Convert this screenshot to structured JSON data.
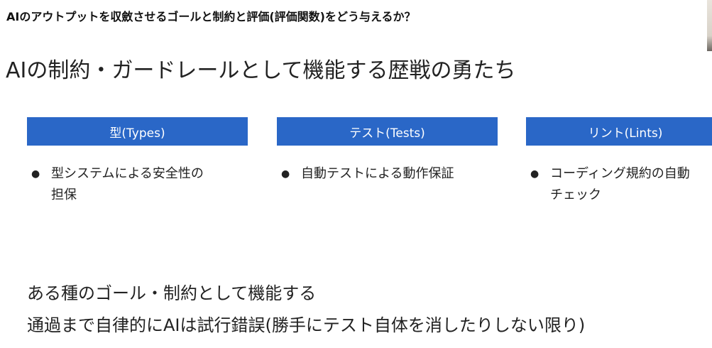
{
  "header": {
    "question": "AIのアウトプットを収斂させるゴールと制約と評価(評価関数)をどう与えるか？"
  },
  "slide": {
    "title": "AIの制約・ガードレールとして機能する歴戦の勇たち"
  },
  "columns": [
    {
      "label": "型(Types)",
      "bullet": "型システムによる安全性の\n担保"
    },
    {
      "label": "テスト(Tests)",
      "bullet": "自動テストによる動作保証"
    },
    {
      "label": "リント(Lints)",
      "bullet": "コーディング規約の自動\nチェック"
    }
  ],
  "bullet_symbol": "●",
  "summary": [
    "ある種のゴール・制約として機能する",
    "通過まで自律的にAIは試行錯誤(勝手にテスト自体を消したりしない限り)"
  ],
  "colors": {
    "accent": "#2a67c7",
    "text": "#222222",
    "background": "#ffffff"
  }
}
